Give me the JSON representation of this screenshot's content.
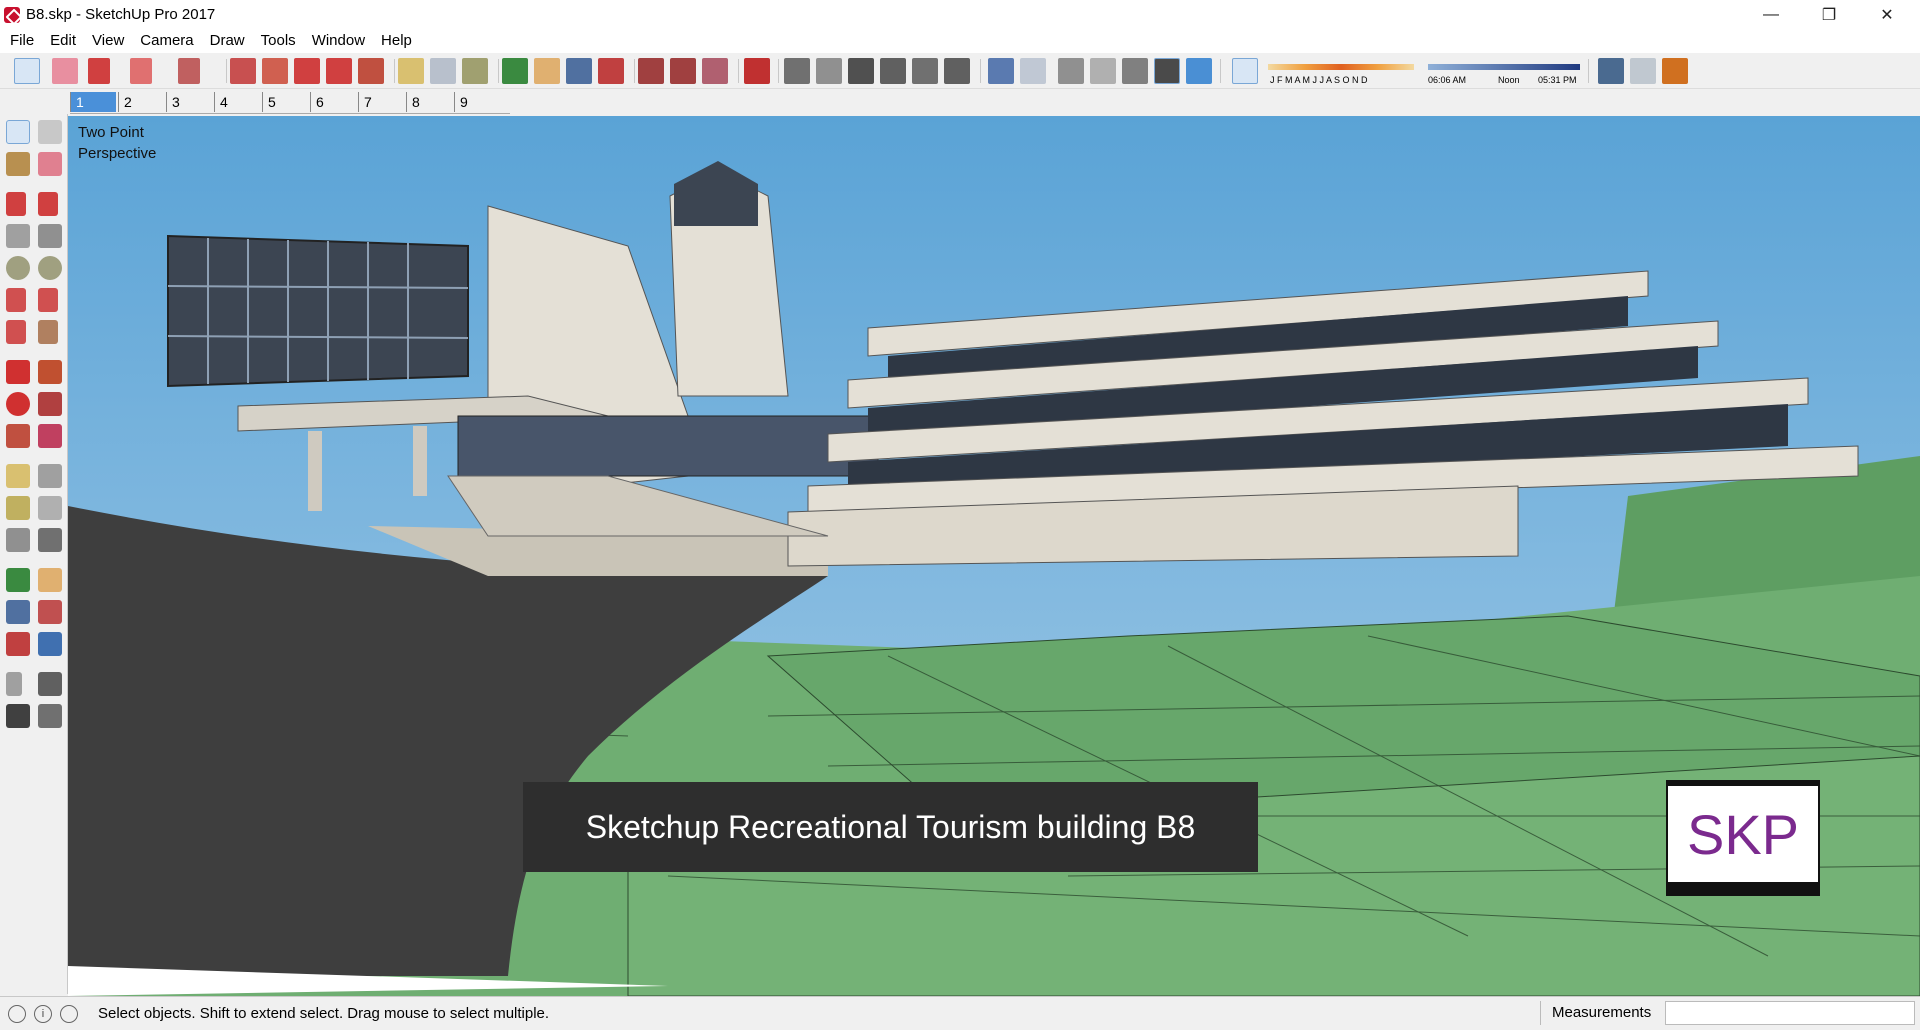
{
  "window": {
    "title": "B8.skp - SketchUp Pro 2017",
    "minimize": "—",
    "maximize": "❐",
    "close": "✕"
  },
  "menu": [
    "File",
    "Edit",
    "View",
    "Camera",
    "Draw",
    "Tools",
    "Window",
    "Help"
  ],
  "shadow": {
    "months": "J F M A M J J A S O N D",
    "time_start": "06:06 AM",
    "time_mid": "Noon",
    "time_end": "05:31 PM"
  },
  "scenes": [
    "1",
    "2",
    "3",
    "4",
    "5",
    "6",
    "7",
    "8",
    "9"
  ],
  "viewport": {
    "camera_line1": "Two Point",
    "camera_line2": "Perspective",
    "caption": "Sketchup Recreational Tourism building B8",
    "logo": "SKP"
  },
  "statusbar": {
    "text": "Select objects. Shift to extend select. Drag mouse to select multiple.",
    "measurements_label": "Measurements",
    "measurements_value": ""
  },
  "colors": {
    "sky": "#6cb1dc",
    "grass": "#6fae72",
    "road": "#3e3e3e",
    "stone": "#e4e0d6",
    "glass": "#3c4552",
    "accent": "#4a90d9"
  }
}
